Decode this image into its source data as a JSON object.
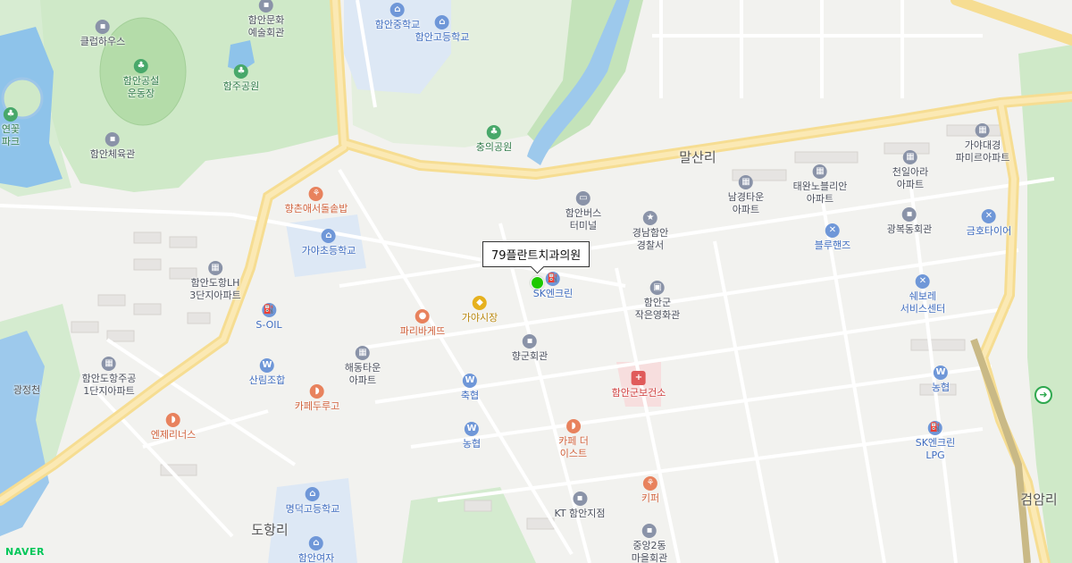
{
  "map": {
    "provider_logo": "NAVER"
  },
  "selected_place": {
    "name": "79플란트치과의원"
  },
  "areas": [
    {
      "id": "malsan",
      "label": "말산리"
    },
    {
      "id": "dohang",
      "label": "도항리"
    },
    {
      "id": "geomam",
      "label": "검암리"
    },
    {
      "id": "gwangjeong",
      "label": "광정천"
    }
  ],
  "pois": [
    {
      "label": "함안중학교",
      "icon": "school-icon",
      "color": "blue"
    },
    {
      "label": "함안고등학교",
      "icon": "school-icon",
      "color": "blue"
    },
    {
      "label": "함안문화\n예술회관",
      "icon": "building-icon",
      "color": "gray"
    },
    {
      "label": "클럽하우스",
      "icon": "building-icon",
      "color": "gray"
    },
    {
      "label": "함안공설\n운동장",
      "icon": "park-icon",
      "color": "green"
    },
    {
      "label": "함주공원",
      "icon": "park-icon",
      "color": "green"
    },
    {
      "label": "연꽃\n파크",
      "icon": "park-icon",
      "color": "green"
    },
    {
      "label": "함안체육관",
      "icon": "building-icon",
      "color": "gray"
    },
    {
      "label": "충의공원",
      "icon": "park-icon",
      "color": "green"
    },
    {
      "label": "향촌애서돌솥밥",
      "icon": "restaurant-icon",
      "color": "orange"
    },
    {
      "label": "가야초등학교",
      "icon": "school-icon",
      "color": "blue"
    },
    {
      "label": "함안버스\n터미널",
      "icon": "bus-icon",
      "color": "gray"
    },
    {
      "label": "경남함안\n경찰서",
      "icon": "police-icon",
      "color": "gray"
    },
    {
      "label": "남경타운\n아파트",
      "icon": "apartment-icon",
      "color": "gray"
    },
    {
      "label": "태완노블리안\n아파트",
      "icon": "apartment-icon",
      "color": "gray"
    },
    {
      "label": "천일아라\n아파트",
      "icon": "apartment-icon",
      "color": "gray"
    },
    {
      "label": "가야대경\n파미르아파트",
      "icon": "apartment-icon",
      "color": "gray"
    },
    {
      "label": "광복동회관",
      "icon": "building-icon",
      "color": "gray"
    },
    {
      "label": "블루핸즈",
      "icon": "wrench-icon",
      "color": "blue"
    },
    {
      "label": "금호타이어",
      "icon": "wrench-icon",
      "color": "blue"
    },
    {
      "label": "함안도항LH\n3단지아파트",
      "icon": "apartment-icon",
      "color": "gray"
    },
    {
      "label": "S-OIL",
      "icon": "gas-station-icon",
      "color": "blue"
    },
    {
      "label": "SK엔크린",
      "icon": "gas-station-icon",
      "color": "blue"
    },
    {
      "label": "가야시장",
      "icon": "market-icon",
      "color": "yellow"
    },
    {
      "label": "파리바게뜨",
      "icon": "bakery-icon",
      "color": "orange"
    },
    {
      "label": "함안군\n작은영화관",
      "icon": "cinema-icon",
      "color": "gray"
    },
    {
      "label": "쉐보레\n서비스센터",
      "icon": "wrench-icon",
      "color": "blue"
    },
    {
      "label": "향군회관",
      "icon": "building-icon",
      "color": "gray"
    },
    {
      "label": "해동타운\n아파트",
      "icon": "apartment-icon",
      "color": "gray"
    },
    {
      "label": "산림조합",
      "icon": "bank-icon",
      "color": "blue"
    },
    {
      "label": "함안도항주공\n1단지아파트",
      "icon": "apartment-icon",
      "color": "gray"
    },
    {
      "label": "카페두루고",
      "icon": "cafe-icon",
      "color": "orange"
    },
    {
      "label": "축협",
      "icon": "bank-icon",
      "color": "blue"
    },
    {
      "label": "함안군보건소",
      "icon": "hospital-icon",
      "color": "red"
    },
    {
      "label": "농협",
      "icon": "bank-icon",
      "color": "blue"
    },
    {
      "label": "엔제리너스",
      "icon": "cafe-icon",
      "color": "orange"
    },
    {
      "label": "농협",
      "icon": "bank-icon",
      "color": "blue"
    },
    {
      "label": "카페 더\n이스트",
      "icon": "cafe-icon",
      "color": "orange"
    },
    {
      "label": "SK엔크린\nLPG",
      "icon": "gas-station-icon",
      "color": "blue"
    },
    {
      "label": "키퍼",
      "icon": "restaurant-icon",
      "color": "orange"
    },
    {
      "label": "KT 함안지점",
      "icon": "building-icon",
      "color": "gray"
    },
    {
      "label": "명덕고등학교",
      "icon": "school-icon",
      "color": "blue"
    },
    {
      "label": "함안여자",
      "icon": "school-icon",
      "color": "blue"
    },
    {
      "label": "중앙2동\n마을회관",
      "icon": "building-icon",
      "color": "gray"
    }
  ]
}
